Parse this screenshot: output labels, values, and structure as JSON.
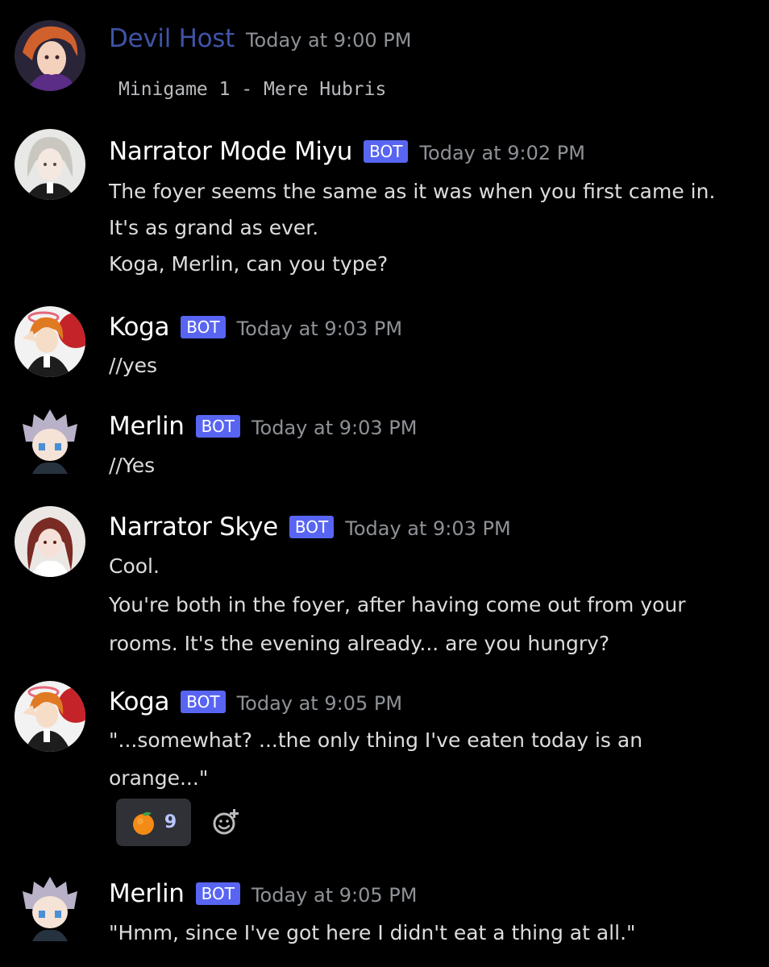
{
  "colors": {
    "background": "#000000",
    "bot_badge": "#5865f2",
    "host_name": "#3f54a6",
    "timestamp": "#8e9297",
    "text": "#dcddde"
  },
  "messages": [
    {
      "author": "Devil Host",
      "timestamp": "Today at 9:00 PM",
      "lines": [
        "Minigame 1 - Mere Hubris"
      ]
    },
    {
      "author": "Narrator Mode Miyu",
      "bot_label": "BOT",
      "timestamp": "Today at 9:02 PM",
      "lines": [
        "The foyer seems the same as it was when you first came in.",
        "It's as grand as ever.",
        "Koga, Merlin, can you type?"
      ]
    },
    {
      "author": "Koga",
      "bot_label": "BOT",
      "timestamp": "Today at 9:03 PM",
      "lines": [
        "//yes"
      ]
    },
    {
      "author": "Merlin",
      "bot_label": "BOT",
      "timestamp": "Today at 9:03 PM",
      "lines": [
        "//Yes"
      ]
    },
    {
      "author": "Narrator Skye",
      "bot_label": "BOT",
      "timestamp": "Today at 9:03 PM",
      "lines": [
        "Cool.",
        "You're both in the foyer, after having come out from your",
        "rooms. It's the evening already... are you hungry?"
      ]
    },
    {
      "author": "Koga",
      "bot_label": "BOT",
      "timestamp": "Today at 9:05 PM",
      "lines": [
        "\"...somewhat? ...the only thing I've eaten today is an",
        "orange...\""
      ],
      "reaction": {
        "emoji": "orange-emoji",
        "count": "9"
      }
    },
    {
      "author": "Merlin",
      "bot_label": "BOT",
      "timestamp": "Today at 9:05 PM",
      "lines": [
        "\"Hmm, since I've got here I didn't eat a thing at all.\""
      ]
    }
  ]
}
